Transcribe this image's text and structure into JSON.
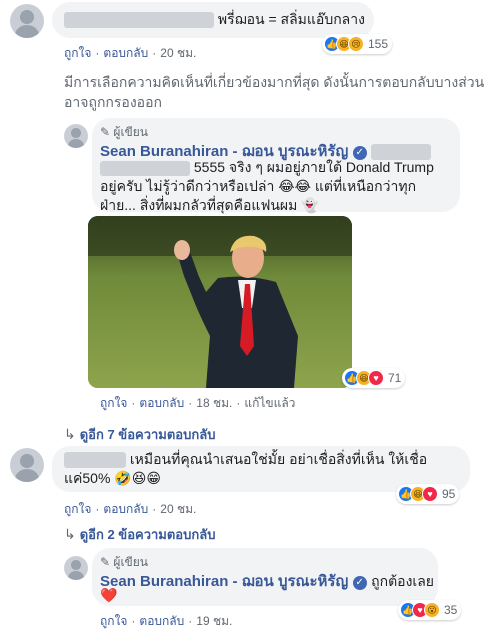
{
  "comment1": {
    "text": "พรี่ฌอน = สลิ่มแอ๊บกลาง",
    "actions": {
      "like": "ถูกใจ",
      "reply": "ตอบกลับ",
      "time": "20 ชม."
    },
    "reactions": {
      "icons": [
        "like-icon",
        "haha-icon",
        "sad-icon"
      ],
      "count": "155"
    }
  },
  "filter_notice": "มีการเลือกความคิดเห็นที่เกี่ยวข้องมากที่สุด ดังนั้นการตอบกลับบางส่วนอาจถูกกรองออก",
  "reply1": {
    "author_tag": "ผู้เขียน",
    "author_name": "Sean Buranahiran - ฌอน บูรณะหิรัญ",
    "text_line1": "5555 จริง ๆ ผมอยู่ภายใต้ Donald Trump",
    "text_line2": "อยู่ครับ ไม่รู้ว่าดีกว่าหรือเปล่า 😂😂 แต่ที่เหนือกว่าทุก",
    "text_line3": "ฝ่าย... สิ่งที่ผมกลัวที่สุดคือแฟนผม 👻",
    "photo_alt": "Donald Trump waving on lawn",
    "actions": {
      "like": "ถูกใจ",
      "reply": "ตอบกลับ",
      "time": "18 ชม.",
      "edited": "แก้ไขแล้ว"
    },
    "reactions": {
      "icons": [
        "like-icon",
        "haha-icon",
        "love-icon"
      ],
      "count": "71"
    }
  },
  "view_more_1": "ดูอีก 7 ข้อความตอบกลับ",
  "comment2": {
    "text_line1": "เหมือนที่คุณนำเสนอใช่มั้ย อย่าเชื่อสิ่งที่เห็น ให้เชื่อ",
    "text_line2": "แค่50% 🤣😆😁",
    "actions": {
      "like": "ถูกใจ",
      "reply": "ตอบกลับ",
      "time": "20 ชม."
    },
    "reactions": {
      "icons": [
        "like-icon",
        "haha-icon",
        "love-icon"
      ],
      "count": "95"
    }
  },
  "view_more_2": "ดูอีก 2 ข้อความตอบกลับ",
  "reply2": {
    "author_tag": "ผู้เขียน",
    "author_name": "Sean Buranahiran - ฌอน บูรณะหิรัญ",
    "text_inline": "ถูกต้องเลย",
    "text_line2": "❤️",
    "actions": {
      "like": "ถูกใจ",
      "reply": "ตอบกลับ",
      "time": "19 ชม."
    },
    "reactions": {
      "icons": [
        "like-icon",
        "love-icon",
        "wow-icon"
      ],
      "count": "35"
    }
  },
  "colors": {
    "link": "#385898",
    "bubble": "#f2f3f5",
    "like": "#1877f2",
    "love": "#f0284a",
    "haha": "#f7b125"
  }
}
